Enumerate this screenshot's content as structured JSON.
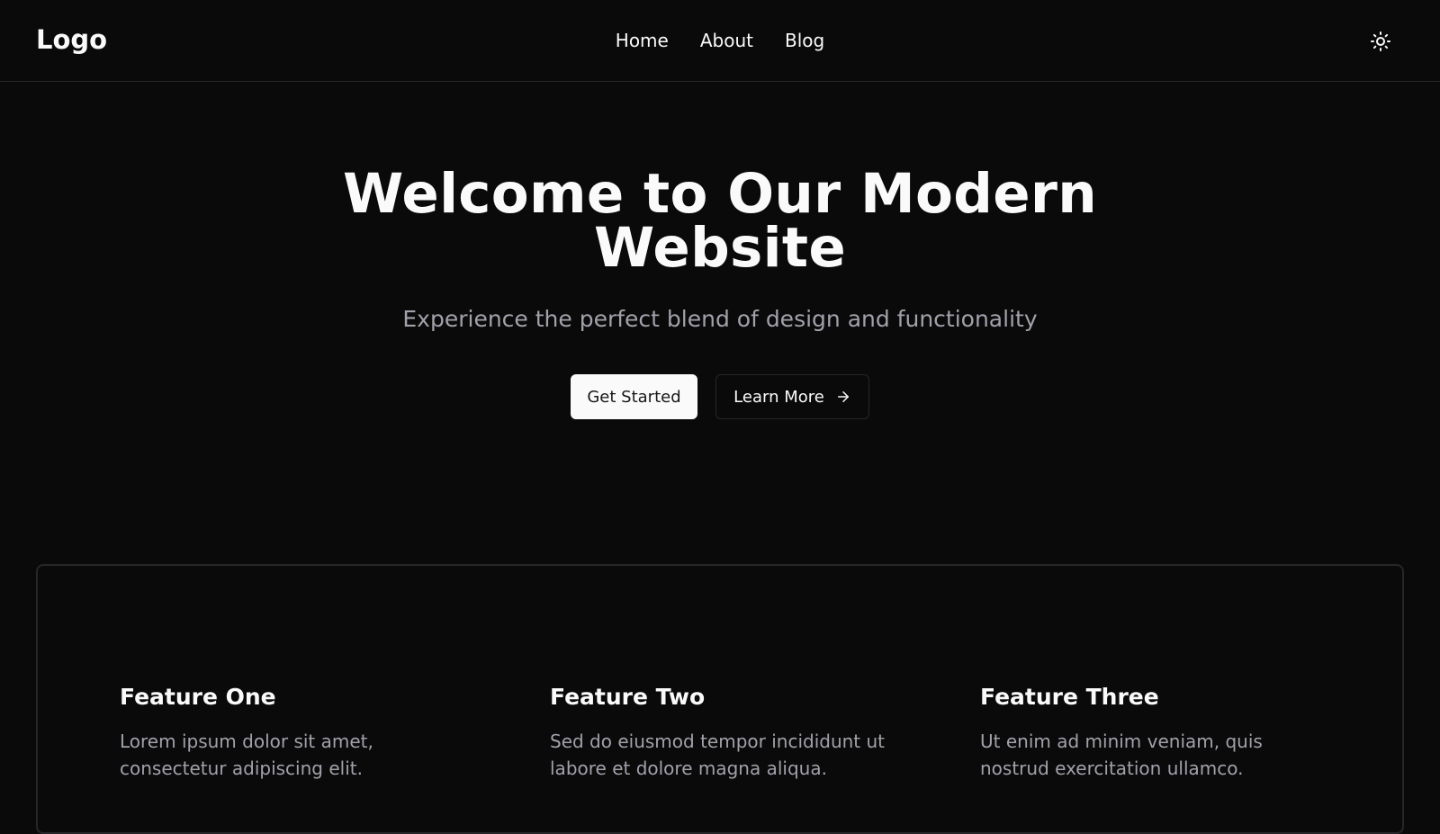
{
  "header": {
    "logo": "Logo",
    "nav": [
      {
        "label": "Home"
      },
      {
        "label": "About"
      },
      {
        "label": "Blog"
      }
    ],
    "theme_toggle_icon": "sun-icon"
  },
  "hero": {
    "title_line1": "Welcome to Our Modern",
    "title_line2": "Website",
    "subtitle": "Experience the perfect blend of design and functionality",
    "primary_button": "Get Started",
    "secondary_button": "Learn More",
    "secondary_button_icon": "arrow-right-icon"
  },
  "features": [
    {
      "title": "Feature One",
      "line1": "Lorem ipsum dolor sit amet,",
      "line2": "consectetur adipiscing elit."
    },
    {
      "title": "Feature Two",
      "line1": "Sed do eiusmod tempor incididunt ut",
      "line2": "labore et dolore magna aliqua."
    },
    {
      "title": "Feature Three",
      "line1": "Ut enim ad minim veniam, quis",
      "line2": "nostrud exercitation ullamco."
    }
  ],
  "colors": {
    "background": "#0a0a0a",
    "foreground": "#fafafa",
    "muted_text": "#a1a1aa",
    "border": "#27272a",
    "primary_button_bg": "#fafafa",
    "primary_button_text": "#18181b"
  }
}
